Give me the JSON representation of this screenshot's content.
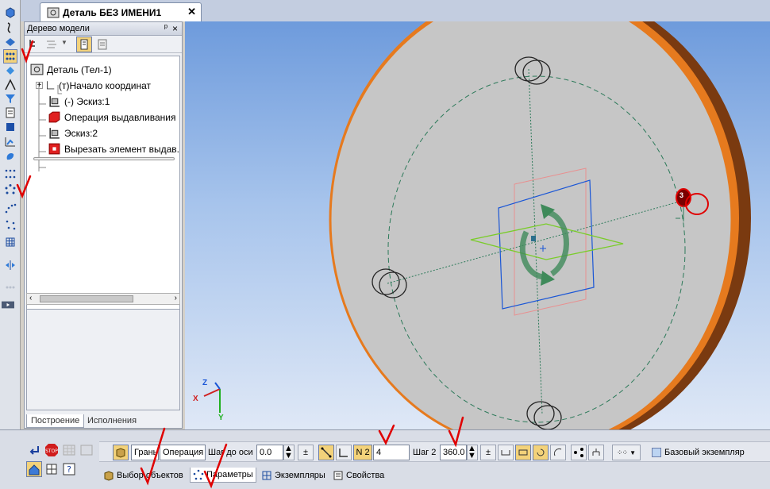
{
  "document": {
    "tab_title": "Деталь БЕЗ ИМЕНИ1"
  },
  "tree": {
    "title": "Дерево модели",
    "nodes": [
      {
        "label": "Деталь (Тел-1)"
      },
      {
        "label": "(т)Начало координат"
      },
      {
        "label": "(-) Эскиз:1"
      },
      {
        "label": "Операция выдавливания"
      },
      {
        "label": "Эскиз:2"
      },
      {
        "label": "Вырезать элемент выдав."
      }
    ],
    "tabs": [
      "Построение",
      "Исполнения"
    ]
  },
  "viewport": {
    "axis_labels": {
      "x": "X",
      "y": "Y",
      "z": "Z"
    },
    "point_marker": "3"
  },
  "props": {
    "face_label": "Грань",
    "operation_field": "Операция в",
    "axis_step_label": "Шаг до оси",
    "axis_step_value": "0.0",
    "n2_label": "N 2",
    "n2_value": "4",
    "step2_label": "Шаг 2",
    "step2_value": "360.0",
    "base_instance_label": "Базовый экземпляр",
    "tabs": [
      "Выбор объектов",
      "Параметры",
      "Экземпляры",
      "Свойства"
    ]
  },
  "colors": {
    "accent": "#f3d27a",
    "annotation": "#e00000",
    "disk_edge": "#e67a1e",
    "disk_face": "#c6c6c6"
  }
}
